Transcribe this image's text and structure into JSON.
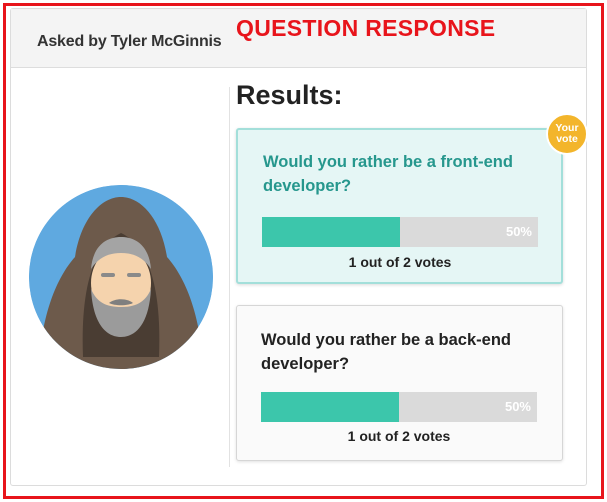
{
  "header": {
    "asked_by": "Asked by Tyler McGinnis",
    "overlay_label": "QUESTION RESPONSE"
  },
  "results": {
    "title": "Results:",
    "your_vote_badge": "Your vote",
    "options": [
      {
        "question": "Would you rather be a front-end developer?",
        "percent": 50,
        "percent_label": "50%",
        "votes_text": "1 out of 2 votes",
        "is_user_vote": true
      },
      {
        "question": "Would you rather be a back-end developer?",
        "percent": 50,
        "percent_label": "50%",
        "votes_text": "1 out of 2 votes",
        "is_user_vote": false
      }
    ]
  },
  "colors": {
    "annotation_red": "#e8141b",
    "bar_fill": "#3cc6ab",
    "bar_track": "#dadada",
    "voted_question_text": "#26978d",
    "badge": "#f3b52b",
    "avatar_background": "#5fa9e0"
  },
  "icons": {
    "avatar": "hooded-bearded-man-avatar"
  }
}
